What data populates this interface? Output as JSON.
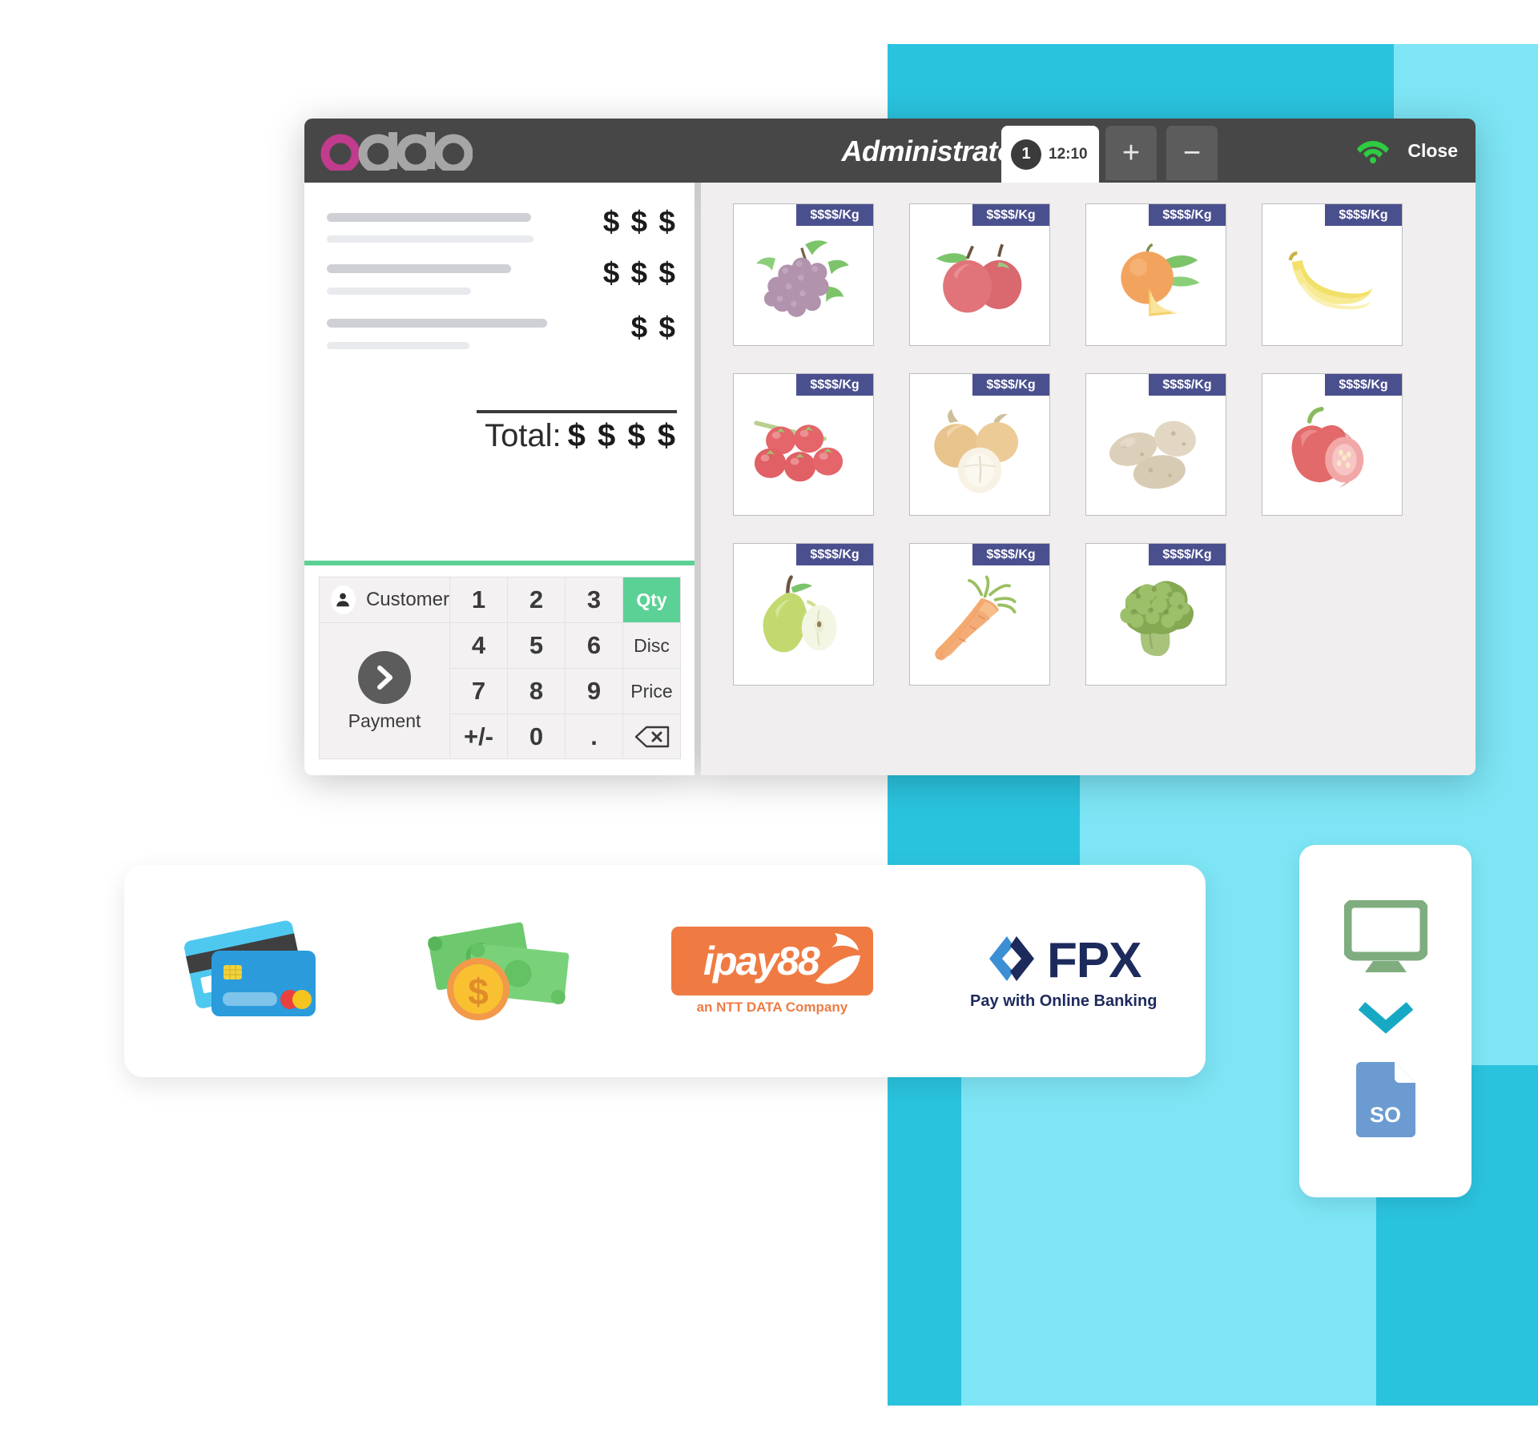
{
  "window": {
    "brand": "odoo",
    "user": "Administrator",
    "order_tab": {
      "number": "1",
      "time": "12:10"
    },
    "add_order_label": "+",
    "remove_order_label": "−",
    "close_label": "Close",
    "wifi_icon": "wifi-icon",
    "wifi_color": "#2ecc40"
  },
  "order": {
    "lines": [
      {
        "amount": "$ $ $"
      },
      {
        "amount": "$ $ $"
      },
      {
        "amount": "$ $"
      }
    ],
    "total_label": "Total:",
    "total_amount": "$ $ $ $"
  },
  "numpad": {
    "customer_label": "Customer",
    "customer_icon": "user-icon",
    "payment_label": "Payment",
    "payment_icon": "chevron-right-icon",
    "keys": [
      {
        "label": "1",
        "type": "num"
      },
      {
        "label": "2",
        "type": "num"
      },
      {
        "label": "3",
        "type": "num"
      },
      {
        "label": "Qty",
        "type": "mode",
        "active": true
      },
      {
        "label": "4",
        "type": "num"
      },
      {
        "label": "5",
        "type": "num"
      },
      {
        "label": "6",
        "type": "num"
      },
      {
        "label": "Disc",
        "type": "mode"
      },
      {
        "label": "7",
        "type": "num"
      },
      {
        "label": "8",
        "type": "num"
      },
      {
        "label": "9",
        "type": "num"
      },
      {
        "label": "Price",
        "type": "mode"
      },
      {
        "label": "+/-",
        "type": "num"
      },
      {
        "label": "0",
        "type": "num"
      },
      {
        "label": ".",
        "type": "num"
      },
      {
        "label": "backspace-icon",
        "type": "icon"
      }
    ],
    "active_color": "#5bd196"
  },
  "products": [
    {
      "name": "grapes",
      "price": "$$$$/Kg"
    },
    {
      "name": "apples",
      "price": "$$$$/Kg"
    },
    {
      "name": "orange",
      "price": "$$$$/Kg"
    },
    {
      "name": "bananas",
      "price": "$$$$/Kg"
    },
    {
      "name": "tomatoes",
      "price": "$$$$/Kg"
    },
    {
      "name": "onions",
      "price": "$$$$/Kg"
    },
    {
      "name": "potatoes",
      "price": "$$$$/Kg"
    },
    {
      "name": "bell-pepper",
      "price": "$$$$/Kg"
    },
    {
      "name": "pear",
      "price": "$$$$/Kg"
    },
    {
      "name": "carrots",
      "price": "$$$$/Kg"
    },
    {
      "name": "broccoli",
      "price": "$$$$/Kg"
    }
  ],
  "payment_methods": [
    {
      "name": "credit-card",
      "label": ""
    },
    {
      "name": "cash",
      "label": ""
    },
    {
      "name": "ipay88",
      "label": "ipay88",
      "tagline": "an NTT DATA Company",
      "color": "#ef7b43"
    },
    {
      "name": "fpx",
      "label": "FPX",
      "tagline": "Pay with Online Banking",
      "color": "#1d2a5c"
    }
  ],
  "side_card": {
    "monitor_icon": "monitor-icon",
    "monitor_color": "#7fad7f",
    "chevron_icon": "chevron-down-icon",
    "chevron_color": "#17a9c4",
    "document_label": "SO",
    "document_color": "#6b9bd1"
  },
  "theme": {
    "teal": "#2ac3de",
    "teal_light": "#7de5f5",
    "header_bg": "#474747",
    "panel_bg": "#f1eeef",
    "badge_bg": "#4a4f8e"
  }
}
